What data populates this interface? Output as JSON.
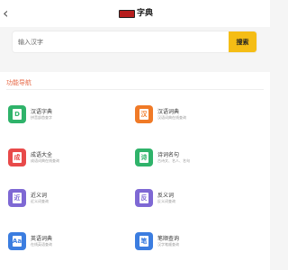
{
  "header": {
    "back_glyph": "‹",
    "logo_text": "字典"
  },
  "search": {
    "placeholder": "输入汉字",
    "button_label": "搜索"
  },
  "section": {
    "title": "功能导航"
  },
  "items": [
    {
      "title": "汉语字典",
      "desc": "拼音部首查字",
      "glyph": "D",
      "icon": "dictionary-icon",
      "color": "#2fb36a"
    },
    {
      "title": "汉语词典",
      "desc": "汉语词典在线查询",
      "glyph": "汉",
      "icon": "word-dictionary-icon",
      "color": "#f07a27"
    },
    {
      "title": "成语大全",
      "desc": "成语词典在线查询",
      "glyph": "成",
      "icon": "idiom-icon",
      "color": "#e84a4a"
    },
    {
      "title": "诗词名句",
      "desc": "古诗文、名人、名句",
      "glyph": "诗",
      "icon": "poetry-icon",
      "color": "#2fb36a"
    },
    {
      "title": "近义词",
      "desc": "近义词查询",
      "glyph": "近",
      "icon": "synonym-icon",
      "color": "#7e68d4"
    },
    {
      "title": "反义词",
      "desc": "反义词查询",
      "glyph": "反",
      "icon": "antonym-icon",
      "color": "#7e68d4"
    },
    {
      "title": "英语词典",
      "desc": "在线英语查询",
      "glyph": "Aa",
      "icon": "english-dictionary-icon",
      "color": "#3b7de0"
    },
    {
      "title": "笔顺查询",
      "desc": "汉字笔顺查询",
      "glyph": "笔",
      "icon": "stroke-order-icon",
      "color": "#3b7de0"
    }
  ]
}
